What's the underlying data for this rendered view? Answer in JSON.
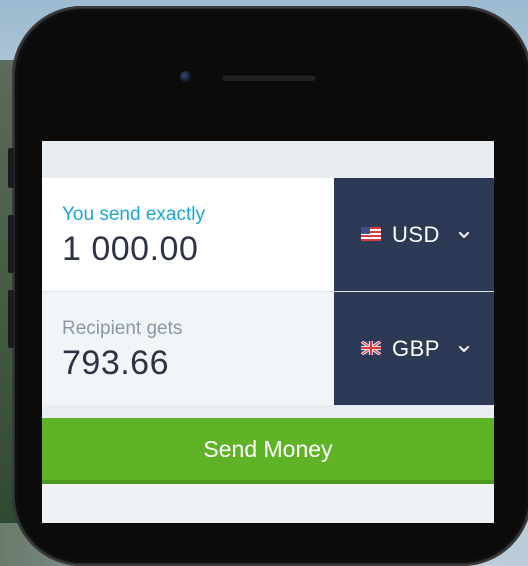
{
  "send": {
    "label": "You send exactly",
    "amount": "1 000.00",
    "currency": "USD",
    "flag_icon": "us-flag-icon"
  },
  "receive": {
    "label": "Recipient gets",
    "amount": "793.66",
    "currency": "GBP",
    "flag_icon": "uk-flag-icon"
  },
  "actions": {
    "send_label": "Send Money"
  },
  "colors": {
    "accent_blue": "#1aa6d9",
    "currency_panel": "#2d3a55",
    "send_button": "#5fb326"
  }
}
